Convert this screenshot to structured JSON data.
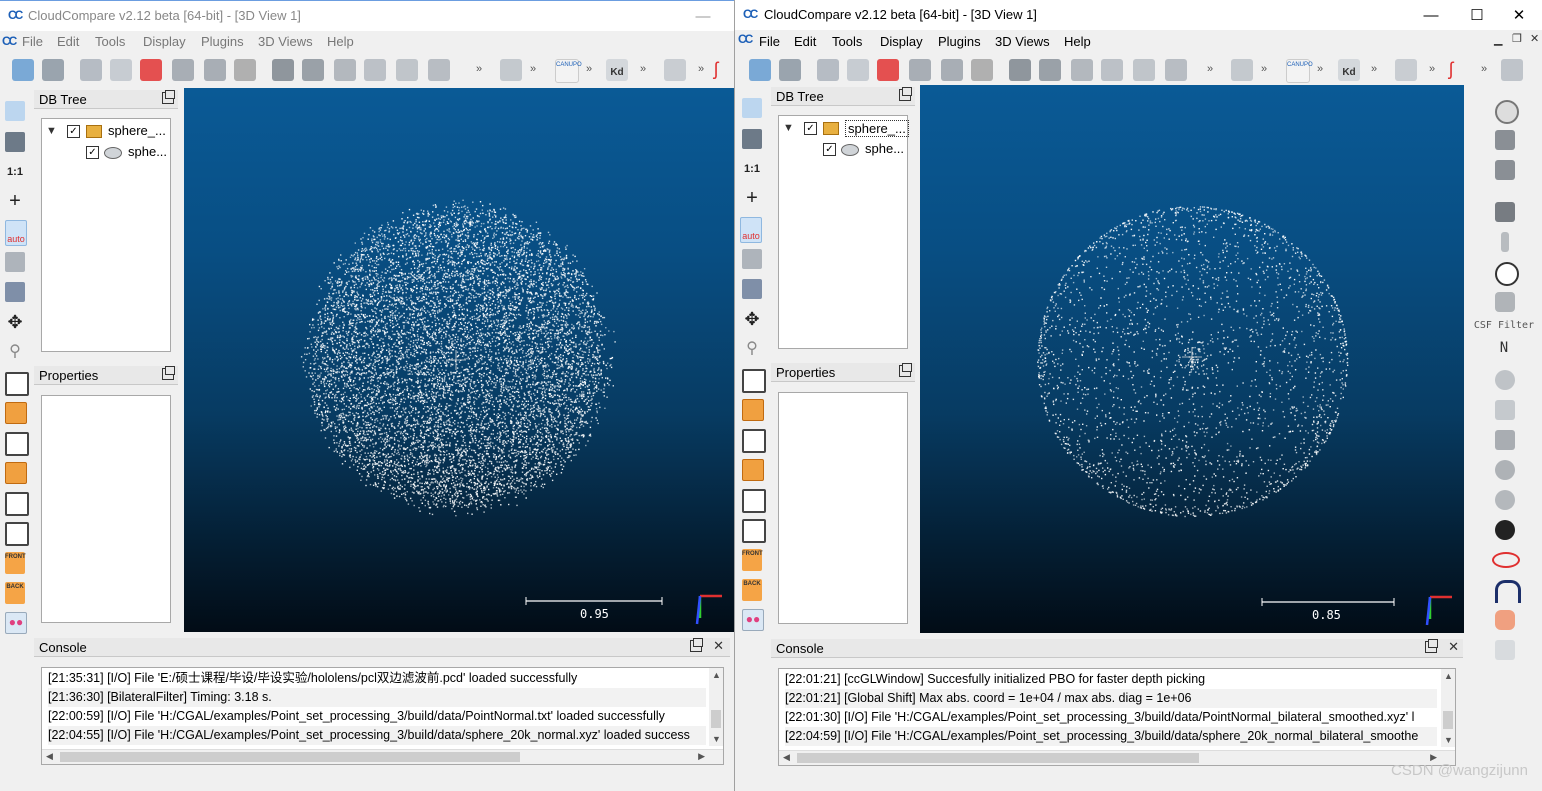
{
  "windows": [
    {
      "id": "left",
      "title": "CloudCompare v2.12 beta [64-bit] - [3D View 1]",
      "menu": [
        "File",
        "Edit",
        "Tools",
        "Display",
        "Plugins",
        "3D Views",
        "Help"
      ],
      "db_tree": {
        "header": "DB Tree",
        "items": [
          {
            "label": "sphere_..."
          },
          {
            "label": "sphe..."
          }
        ]
      },
      "properties_header": "Properties",
      "view": {
        "scale_label": "0.95"
      },
      "console": {
        "header": "Console",
        "lines": [
          "[21:35:31] [I/O] File 'E:/硕士课程/毕设/毕设实验/hololens/pcl双边滤波前.pcd' loaded successfully",
          "[21:36:30] [BilateralFilter] Timing: 3.18 s.",
          "[22:00:59] [I/O] File 'H:/CGAL/examples/Point_set_processing_3/build/data/PointNormal.txt' loaded successfully",
          "[22:04:55] [I/O] File 'H:/CGAL/examples/Point_set_processing_3/build/data/sphere_20k_normal.xyz' loaded success"
        ]
      }
    },
    {
      "id": "right",
      "title": "CloudCompare v2.12 beta [64-bit] - [3D View 1]",
      "menu": [
        "File",
        "Edit",
        "Tools",
        "Display",
        "Plugins",
        "3D Views",
        "Help"
      ],
      "db_tree": {
        "header": "DB Tree",
        "items": [
          {
            "label": "sphere_..."
          },
          {
            "label": "sphe..."
          }
        ]
      },
      "properties_header": "Properties",
      "view": {
        "scale_label": "0.85"
      },
      "console": {
        "header": "Console",
        "lines": [
          "[22:01:21] [ccGLWindow] Succesfully initialized PBO for faster depth picking",
          "[22:01:21] [Global Shift] Max abs. coord = 1e+04 / max abs. diag = 1e+06",
          "[22:01:30] [I/O] File 'H:/CGAL/examples/Point_set_processing_3/build/data/PointNormal_bilateral_smoothed.xyz' l",
          "[22:04:59] [I/O] File 'H:/CGAL/examples/Point_set_processing_3/build/data/sphere_20k_normal_bilateral_smoothe"
        ]
      },
      "plugin_labels": {
        "csf": "CSF Filter",
        "normal": "N"
      }
    }
  ],
  "left_toolbar_labels": {
    "one_to_one": "1:1",
    "auto": "auto",
    "front": "FRONT",
    "back": "BACK"
  },
  "toolbar_labels": {
    "canupo": "CANUPO",
    "kd": "Kd"
  },
  "caption": {
    "minimize": "—",
    "maximize": "☐",
    "close": "✕"
  },
  "watermark": "CSDN @wangzijunn",
  "colors": {
    "view_top": "#0a5a96",
    "view_bottom": "#020c16",
    "points": "#ffffff",
    "app_blue": "#1c5fb7"
  }
}
